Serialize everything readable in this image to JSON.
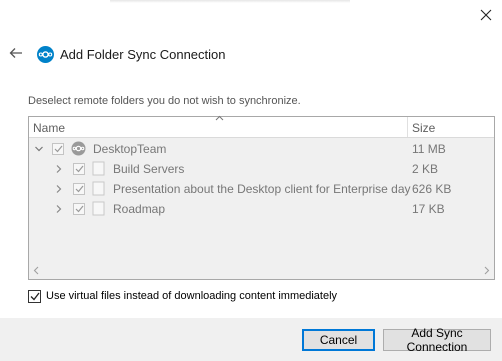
{
  "dialog": {
    "title": "Add Folder Sync Connection",
    "instructions": "Deselect remote folders you do not wish to synchronize."
  },
  "tree": {
    "columns": {
      "name": "Name",
      "size": "Size"
    },
    "root": {
      "label": "DesktopTeam",
      "size": "11 MB",
      "checked": true,
      "expanded": true
    },
    "children": [
      {
        "label": "Build Servers",
        "size": "2 KB",
        "checked": true
      },
      {
        "label": "Presentation about the Desktop client for Enterprise day",
        "size": "626 KB",
        "checked": true
      },
      {
        "label": "Roadmap",
        "size": "17 KB",
        "checked": true
      }
    ]
  },
  "options": {
    "virtual_files_label": "Use virtual files instead of downloading content immediately",
    "virtual_files_checked": true
  },
  "buttons": {
    "cancel": "Cancel",
    "add": "Add Sync Connection"
  },
  "colors": {
    "accent": "#0082c9",
    "focus_border": "#0078d7",
    "footer_bg": "#f0f0f0"
  }
}
